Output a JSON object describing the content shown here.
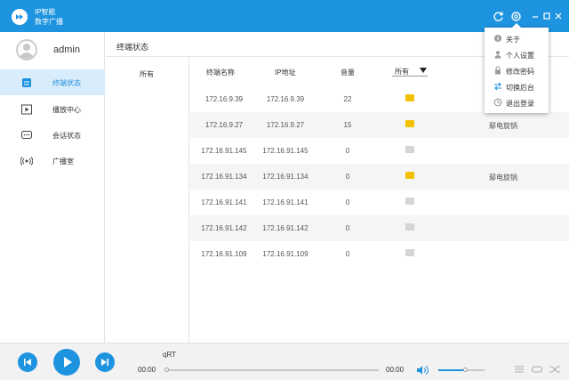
{
  "app": {
    "name_line1": "IP智能",
    "name_line2": "数字广播"
  },
  "user": {
    "name": "admin"
  },
  "sidebar": {
    "items": [
      {
        "label": "终端状态",
        "icon": "terminal-icon",
        "active": true
      },
      {
        "label": "播放中心",
        "icon": "play-center-icon",
        "active": false
      },
      {
        "label": "会话状态",
        "icon": "chat-icon",
        "active": false
      },
      {
        "label": "广播室",
        "icon": "broadcast-icon",
        "active": false
      }
    ]
  },
  "content": {
    "title": "终端状态"
  },
  "groups": [
    "所有"
  ],
  "table": {
    "headers": {
      "name": "终端名称",
      "ip": "IP地址",
      "volume": "音量"
    },
    "filter": "所有",
    "rows": [
      {
        "name": "172.16.9.39",
        "ip": "172.16.9.39",
        "volume": "22",
        "status": "active",
        "task": ""
      },
      {
        "name": "172.16.9.27",
        "ip": "172.16.9.27",
        "volume": "15",
        "status": "active",
        "task": "鄢电旋锅"
      },
      {
        "name": "172.16.91.145",
        "ip": "172.16.91.145",
        "volume": "0",
        "status": "idle",
        "task": ""
      },
      {
        "name": "172.16.91.134",
        "ip": "172.16.91.134",
        "volume": "0",
        "status": "active",
        "task": "鄢电旋锅"
      },
      {
        "name": "172.16.91.141",
        "ip": "172.16.91.141",
        "volume": "0",
        "status": "idle",
        "task": ""
      },
      {
        "name": "172.16.91.142",
        "ip": "172.16.91.142",
        "volume": "0",
        "status": "idle",
        "task": ""
      },
      {
        "name": "172.16.91.109",
        "ip": "172.16.91.109",
        "volume": "0",
        "status": "idle",
        "task": ""
      }
    ]
  },
  "menu": {
    "items": [
      {
        "label": "关于",
        "icon": "info-icon"
      },
      {
        "label": "个人设置",
        "icon": "user-icon"
      },
      {
        "label": "修改密码",
        "icon": "lock-icon"
      },
      {
        "label": "切换后台",
        "icon": "switch-icon"
      },
      {
        "label": "退出登录",
        "icon": "logout-icon"
      }
    ]
  },
  "player": {
    "track": "qRT",
    "current_time": "00:00",
    "total_time": "00:00",
    "progress": 0,
    "volume": 0.6
  },
  "colors": {
    "accent": "#1e93e0",
    "status_active": "#f2c200",
    "status_idle": "#d5d5d5"
  }
}
